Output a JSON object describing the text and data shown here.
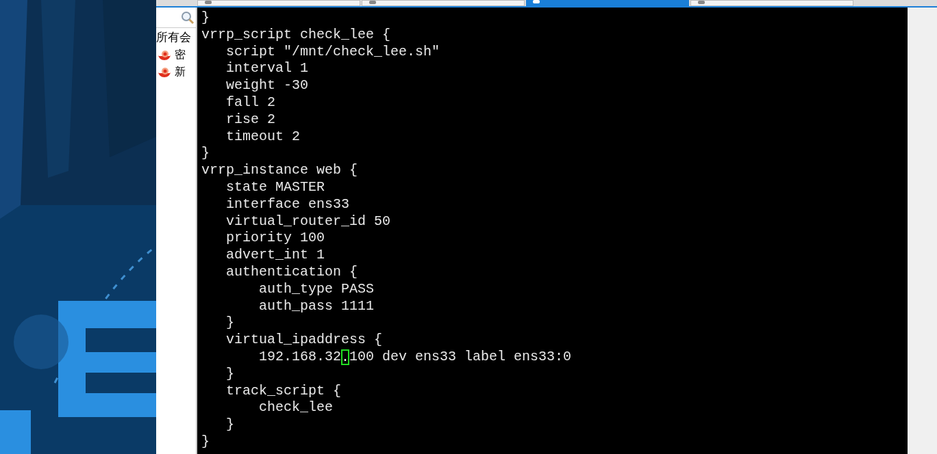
{
  "tabs": [
    {
      "selected": false
    },
    {
      "selected": false
    },
    {
      "selected": true
    },
    {
      "selected": false
    }
  ],
  "sidebar": {
    "heading": "所有会",
    "items": [
      {
        "label": "密"
      },
      {
        "label": "新"
      }
    ]
  },
  "terminal": {
    "lines": [
      {
        "segments": [
          {
            "text": "}",
            "cursor": false
          }
        ]
      },
      {
        "segments": [
          {
            "text": "vrrp_script check_lee {",
            "cursor": false
          }
        ]
      },
      {
        "segments": [
          {
            "text": "   script \"/mnt/check_lee.sh\"",
            "cursor": false
          }
        ]
      },
      {
        "segments": [
          {
            "text": "   interval 1",
            "cursor": false
          }
        ]
      },
      {
        "segments": [
          {
            "text": "   weight -30",
            "cursor": false
          }
        ]
      },
      {
        "segments": [
          {
            "text": "   fall 2",
            "cursor": false
          }
        ]
      },
      {
        "segments": [
          {
            "text": "   rise 2",
            "cursor": false
          }
        ]
      },
      {
        "segments": [
          {
            "text": "   timeout 2",
            "cursor": false
          }
        ]
      },
      {
        "segments": [
          {
            "text": "}",
            "cursor": false
          }
        ]
      },
      {
        "segments": [
          {
            "text": "vrrp_instance web {",
            "cursor": false
          }
        ]
      },
      {
        "segments": [
          {
            "text": "   state MASTER",
            "cursor": false
          }
        ]
      },
      {
        "segments": [
          {
            "text": "   interface ens33",
            "cursor": false
          }
        ]
      },
      {
        "segments": [
          {
            "text": "   virtual_router_id 50",
            "cursor": false
          }
        ]
      },
      {
        "segments": [
          {
            "text": "   priority 100",
            "cursor": false
          }
        ]
      },
      {
        "segments": [
          {
            "text": "   advert_int 1",
            "cursor": false
          }
        ]
      },
      {
        "segments": [
          {
            "text": "   authentication {",
            "cursor": false
          }
        ]
      },
      {
        "segments": [
          {
            "text": "       auth_type PASS",
            "cursor": false
          }
        ]
      },
      {
        "segments": [
          {
            "text": "       auth_pass 1111",
            "cursor": false
          }
        ]
      },
      {
        "segments": [
          {
            "text": "   }",
            "cursor": false
          }
        ]
      },
      {
        "segments": [
          {
            "text": "   virtual_ipaddress {",
            "cursor": false
          }
        ]
      },
      {
        "segments": [
          {
            "text": "       192.168.32",
            "cursor": false
          },
          {
            "text": ".",
            "cursor": true
          },
          {
            "text": "100 dev ens33 label ens33:0",
            "cursor": false
          }
        ]
      },
      {
        "segments": [
          {
            "text": "   }",
            "cursor": false
          }
        ]
      },
      {
        "segments": [
          {
            "text": "   track_script {",
            "cursor": false
          }
        ]
      },
      {
        "segments": [
          {
            "text": "       check_lee",
            "cursor": false
          }
        ]
      },
      {
        "segments": [
          {
            "text": "   }",
            "cursor": false
          }
        ]
      },
      {
        "segments": [
          {
            "text": "}",
            "cursor": false
          }
        ]
      }
    ]
  }
}
